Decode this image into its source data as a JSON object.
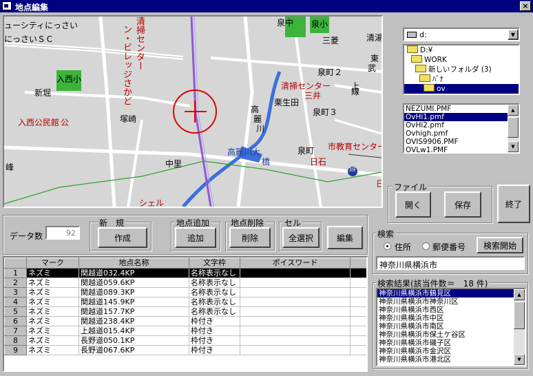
{
  "window": {
    "title": "地点編集",
    "close": "×"
  },
  "map": {
    "labels": {
      "l1": "ューシティにっさい",
      "l2": "にっさいＳＣ",
      "l3": "清掃センター",
      "l4": "ン・ビレッジさかど",
      "l5": "入西小",
      "l6": "新堀",
      "l7": "入西公民館",
      "l7b": "公",
      "l8": "塚崎",
      "l9": "中里",
      "l10": "峰",
      "l11": "泉中",
      "l12": "泉小",
      "l13": "三菱",
      "l14": "清湯",
      "l15": "東",
      "l16": "武",
      "l17": "泉町２",
      "l18": "清掃センター",
      "l19": "三井",
      "l20": "栗生田",
      "l21": "泉町３",
      "l22": "高",
      "l23": "麗",
      "l24": "川",
      "l25": "上",
      "l26": "線",
      "l27": "高麗川大",
      "l28": "橋",
      "l29": "泉町",
      "l30": "市教育センター",
      "l31": "日石",
      "l32": "日石",
      "l33": "シェル",
      "l34": "39"
    }
  },
  "drive": {
    "value": "d:"
  },
  "folders": [
    "D:¥",
    "WORK",
    "新しいフォルダ (3)",
    "ﾊﾞﾅ",
    "ov"
  ],
  "files": [
    "NEZUMI.PMF",
    "OvHi1.pmf",
    "OvHi2.pmf",
    "Ovhigh.pmf",
    "OVIS9906.PMF",
    "OVLw1.PMF"
  ],
  "file_group": {
    "label": "ファイル",
    "open": "開く",
    "save": "保存"
  },
  "exit": "終了",
  "data_count": {
    "label": "データ数",
    "value": "92"
  },
  "groups": {
    "new": {
      "label": "新　規",
      "button": "作成"
    },
    "add": {
      "label": "地点追加",
      "button": "追加"
    },
    "del": {
      "label": "地点削除",
      "button": "削除"
    },
    "cell": {
      "label": "セル",
      "button": "全選択"
    }
  },
  "edit_button": "編集",
  "search": {
    "label": "検索",
    "opt1": "住所",
    "opt2": "郵便番号",
    "button": "検索開始",
    "value": "神奈川県横浜市"
  },
  "results": {
    "label": "検索結果(該当件数＝　18 件)",
    "items": [
      "神奈川県横浜市鶴見区",
      "神奈川県横浜市神奈川区",
      "神奈川県横浜市西区",
      "神奈川県横浜市中区",
      "神奈川県横浜市南区",
      "神奈川県横浜市保土ケ谷区",
      "神奈川県横浜市磯子区",
      "神奈川県横浜市金沢区",
      "神奈川県横浜市港北区"
    ]
  },
  "table": {
    "headers": [
      "マーク",
      "地点名称",
      "文字枠",
      "ポイスワード"
    ],
    "rows": [
      {
        "n": "1",
        "mark": "ネズミ",
        "name": "関越道032.4KP",
        "frame": "名称表示なし",
        "voice": ""
      },
      {
        "n": "2",
        "mark": "ネズミ",
        "name": "関越道059.6KP",
        "frame": "名称表示なし",
        "voice": ""
      },
      {
        "n": "3",
        "mark": "ネズミ",
        "name": "関越道089.3KP",
        "frame": "名称表示なし",
        "voice": ""
      },
      {
        "n": "4",
        "mark": "ネズミ",
        "name": "関越道145.9KP",
        "frame": "名称表示なし",
        "voice": ""
      },
      {
        "n": "5",
        "mark": "ネズミ",
        "name": "関越道157.7KP",
        "frame": "名称表示なし",
        "voice": ""
      },
      {
        "n": "6",
        "mark": "ネズミ",
        "name": "関越道238.4KP",
        "frame": "枠付き",
        "voice": ""
      },
      {
        "n": "7",
        "mark": "ネズミ",
        "name": "上越道015.4KP",
        "frame": "枠付き",
        "voice": ""
      },
      {
        "n": "8",
        "mark": "ネズミ",
        "name": "長野道050.1KP",
        "frame": "枠付き",
        "voice": ""
      },
      {
        "n": "9",
        "mark": "ネズミ",
        "name": "長野道067.6KP",
        "frame": "枠付き",
        "voice": ""
      }
    ]
  }
}
